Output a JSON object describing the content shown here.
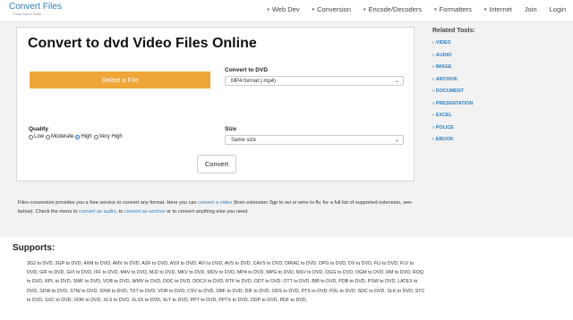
{
  "header": {
    "logo_title": "Convert Files",
    "logo_sub": "From Dan's Tools",
    "nav": [
      {
        "label": "Web Dev",
        "dropdown": true
      },
      {
        "label": "Conversion",
        "dropdown": true
      },
      {
        "label": "Encode/Decoders",
        "dropdown": true
      },
      {
        "label": "Formatters",
        "dropdown": true
      },
      {
        "label": "Internet",
        "dropdown": true
      },
      {
        "label": "Join",
        "dropdown": false
      },
      {
        "label": "Login",
        "dropdown": false
      }
    ]
  },
  "main": {
    "title": "Convert to dvd Video Files Online",
    "select_file_label": "Select a File",
    "convert_to_label": "Convert to DVD",
    "format_value": "MP4 format (.mp4)",
    "quality_label": "Quality",
    "quality_options": [
      "Low",
      "Moderate",
      "High",
      "Very High"
    ],
    "quality_selected": "High",
    "size_label": "Size",
    "size_value": "Same size",
    "convert_button": "Convert"
  },
  "description": {
    "p1": "Files-conversion provides you a free service to convert any format. Here you can ",
    "link1": "convert a video",
    "p2": " (from extension 3gp to avi or wmv to flv, for a full list of supported extension, see-below). Check the menu to ",
    "link2": "convert an audio",
    "p3": ", to ",
    "link3": "convert an archive",
    "p4": " or to convert anything else you need."
  },
  "sidebar": {
    "title": "Related Tools:",
    "items": [
      "VIDEO",
      "AUDIO",
      "IMAGE",
      "ARCHIVE",
      "DOCUMENT",
      "PRESENTATION",
      "EXCEL",
      "POLICE",
      "EBOOK"
    ]
  },
  "supports": {
    "title": "Supports:",
    "text": "3G2 to DVD, 3GP to DVD, 4XM to DVD, AMV to DVD, ASF to DVD, ASX to DVD, AVI to DVD, AVS to DVD, CAVS to DVD, DIRAC to DVD, DPG to DVD, DV to DVD, FLI to DVD, FLV to DVD, GIF to DVD, GVI to DVD, IFF to DVD, M4V to DVD, MJ2 to DVD, MKV to DVD, MOV to DVD, MP4 to DVD, MPG to DVD, NSV to DVD, OGG to DVD, OGM to DVD, RM to DVD, ROQ to DVD, RPL to DVD, SWF to DVD, VOB to DVD, WMV to DVD, DOC to DVD, DOCX to DVD, RTF to DVD, ODT to DVD, OTT to DVD, BIB to DVD, PDB to DVD, PSW to DVD, LATEX to DVD, SDW to DVD, STW to DVD, SXW to DVD, TXT to DVD, VOR to DVD, CSV to DVD, DBF to DVD, DIF to DVD, ODS to DVD, PTS to DVD, PXL to DVD, SDC to DVD, SLK to DVD, STC to DVD, SXC to DVD, VOR to DVD, XLS to DVD, XLSX to DVD, XLT to DVD, PPT to DVD, PPTX to DVD, ODP to DVD, PDF to DVD,"
  },
  "colors": {
    "accent": "#2f7fc1",
    "button_orange": "#f0a63a",
    "radio_selected": "#2b6fd6"
  }
}
